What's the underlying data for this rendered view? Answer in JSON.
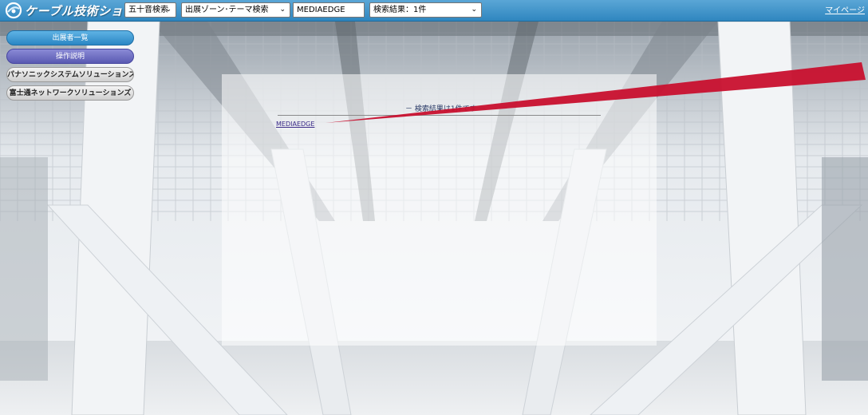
{
  "header": {
    "logo_text": "ケーブル技術ショー",
    "syllabary_select": {
      "selected": "五十音検索"
    },
    "zone_select": {
      "selected": "出展ゾーン･テーマ検索"
    },
    "keyword_input": {
      "value": "MEDIAEDGE"
    },
    "results_select": {
      "selected": "検索結果：1件"
    },
    "mypage_link": "マイページ"
  },
  "menu": {
    "exhibitors": "出展者一覧",
    "instructions": "操作説明",
    "company1": "パナソニックシステムソリューションズジャパン",
    "company2": "富士通ネットワークソリューションズ"
  },
  "results": {
    "title": "－ 検索結果は1件です －",
    "items": [
      "MEDIAEDGE"
    ]
  },
  "colors": {
    "topbar": "#2f86bf",
    "arrow": "#c8102e"
  }
}
